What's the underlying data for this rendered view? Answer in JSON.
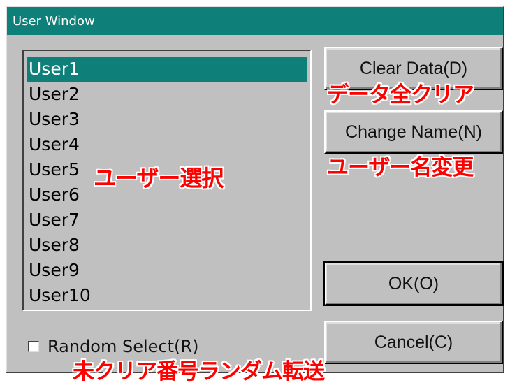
{
  "window": {
    "title": "User Window"
  },
  "users": [
    {
      "label": "User1",
      "selected": true
    },
    {
      "label": "User2",
      "selected": false
    },
    {
      "label": "User3",
      "selected": false
    },
    {
      "label": "User4",
      "selected": false
    },
    {
      "label": "User5",
      "selected": false
    },
    {
      "label": "User6",
      "selected": false
    },
    {
      "label": "User7",
      "selected": false
    },
    {
      "label": "User8",
      "selected": false
    },
    {
      "label": "User9",
      "selected": false
    },
    {
      "label": "User10",
      "selected": false
    }
  ],
  "buttons": {
    "clear_data": "Clear Data(D)",
    "change_name": "Change Name(N)",
    "ok": "OK(O)",
    "cancel": "Cancel(C)"
  },
  "options": {
    "random_select": "Random Select(R)",
    "random_select_checked": false
  },
  "annotations": {
    "clear_data": "データ全クリア",
    "change_name": "ユーザー名変更",
    "user_select": "ユーザー選択",
    "random_select": "未クリア番号ランダム転送"
  },
  "colors": {
    "title_bar": "#0f7f79",
    "selected_item": "#0f7f79",
    "dialog_bg": "#c0c0c0",
    "annotation_text": "#ff0000"
  }
}
